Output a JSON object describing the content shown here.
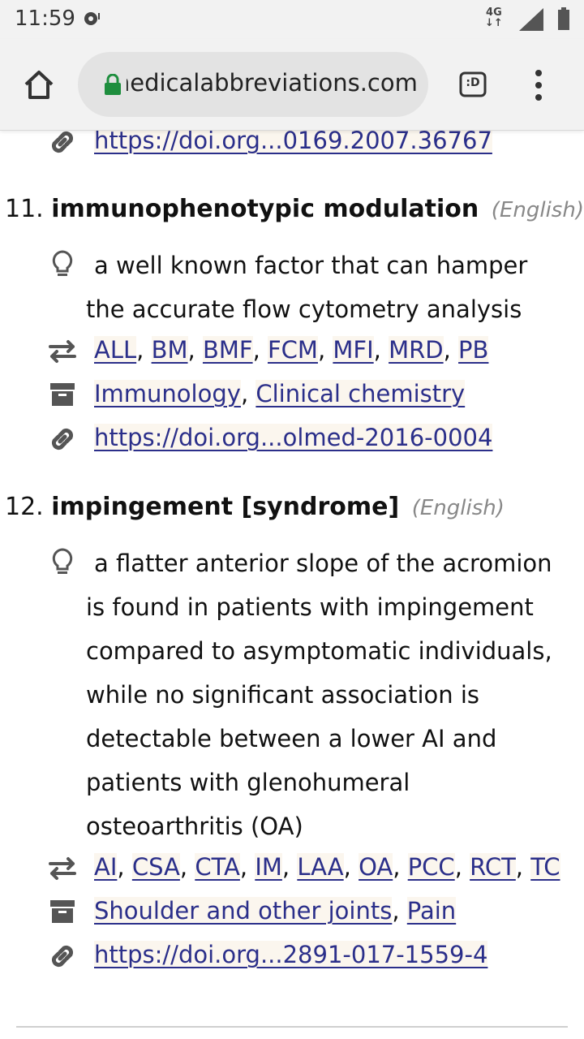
{
  "status_bar": {
    "time": "11:59",
    "network": "4G",
    "icons": [
      "notification-icon",
      "signal-icon",
      "battery-icon"
    ]
  },
  "browser": {
    "url": "medicalabbreviations.com",
    "tabs_label": ":D",
    "icons": [
      "home-icon",
      "lock-icon",
      "tabs-icon",
      "more-menu-icon"
    ]
  },
  "top_link": "https://doi.org...0169.2007.36767",
  "entries": [
    {
      "number": "11.",
      "term": "immunophenotypic modulation",
      "language": "(English)",
      "definition_lines": [
        "a well known factor that can hamper",
        "the accurate flow cytometry analysis"
      ],
      "abbreviations": [
        "ALL",
        "BM",
        "BMF",
        "FCM",
        "MFI",
        "MRD",
        "PB"
      ],
      "categories": [
        "Immunology",
        "Clinical chemistry"
      ],
      "link": "https://doi.org...olmed-2016-0004"
    },
    {
      "number": "12.",
      "term": "impingement [syndrome]",
      "language": "(English)",
      "definition_lines": [
        "a flatter anterior slope of the acromion",
        "is found in patients with impingement",
        "compared to asymptomatic individuals,",
        "while no significant association is",
        "detectable between a lower AI and",
        "patients with glenohumeral",
        "osteoarthritis (OA)"
      ],
      "abbreviations": [
        "AI",
        "CSA",
        "CTA",
        "IM",
        "LAA",
        "OA",
        "PCC",
        "RCT",
        "TC"
      ],
      "categories": [
        "Shoulder and other joints",
        "Pain"
      ],
      "link": "https://doi.org...2891-017-1559-4"
    }
  ],
  "colors": {
    "link": "#2b2f8a",
    "link_background": "#fbf6ee",
    "lock_green": "#1e8e3e",
    "language_gray": "#888888",
    "icon_gray": "#555555"
  }
}
